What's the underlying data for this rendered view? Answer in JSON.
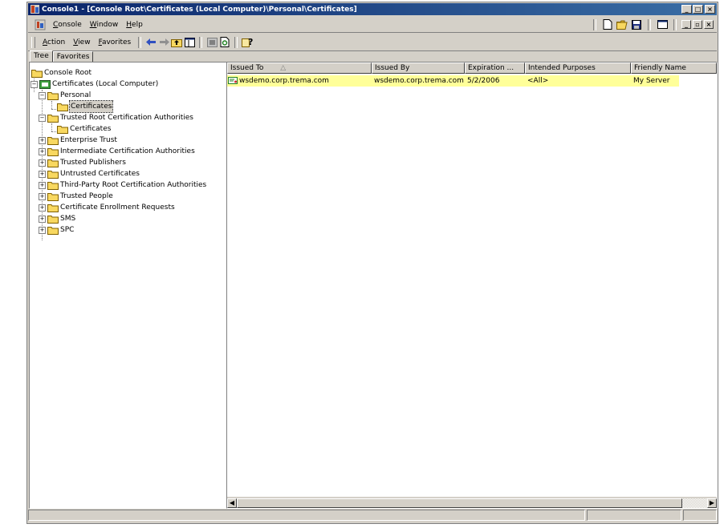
{
  "window": {
    "title": "Console1 - [Console Root\\Certificates (Local Computer)\\Personal\\Certificates]",
    "minimize_label": "_",
    "maximize_label": "□",
    "close_label": "×"
  },
  "menubar": {
    "items": [
      {
        "label": "Console"
      },
      {
        "label": "Window"
      },
      {
        "label": "Help"
      }
    ],
    "mdi_min": "_",
    "mdi_restore": "▫",
    "mdi_close": "×"
  },
  "toolbar": {
    "items": [
      {
        "label": "Action"
      },
      {
        "label": "View"
      },
      {
        "label": "Favorites"
      }
    ]
  },
  "tabs": [
    {
      "label": "Tree"
    },
    {
      "label": "Favorites"
    }
  ],
  "tree": {
    "root": "Console Root",
    "snapin": "Certificates (Local Computer)",
    "personal": "Personal",
    "personal_certs": "Certificates",
    "trusted_root": "Trusted Root Certification Authorities",
    "trusted_root_certs": "Certificates",
    "stores": [
      "Enterprise Trust",
      "Intermediate Certification Authorities",
      "Trusted Publishers",
      "Untrusted Certificates",
      "Third-Party Root Certification Authorities",
      "Trusted People",
      "Certificate Enrollment Requests",
      "SMS",
      "SPC"
    ]
  },
  "list": {
    "columns": [
      "Issued To",
      "Issued By",
      "Expiration ...",
      "Intended Purposes",
      "Friendly Name"
    ],
    "sort_indicator": "△",
    "rows": [
      {
        "issued_to": "wsdemo.corp.trema.com",
        "issued_by": "wsdemo.corp.trema.com",
        "expiration": "5/2/2006",
        "purposes": "<All>",
        "friendly_name": "My Server"
      }
    ]
  },
  "colors": {
    "title_bar": "#0a246a",
    "row_highlight": "#ffff99",
    "chrome": "#d4d0c8"
  }
}
